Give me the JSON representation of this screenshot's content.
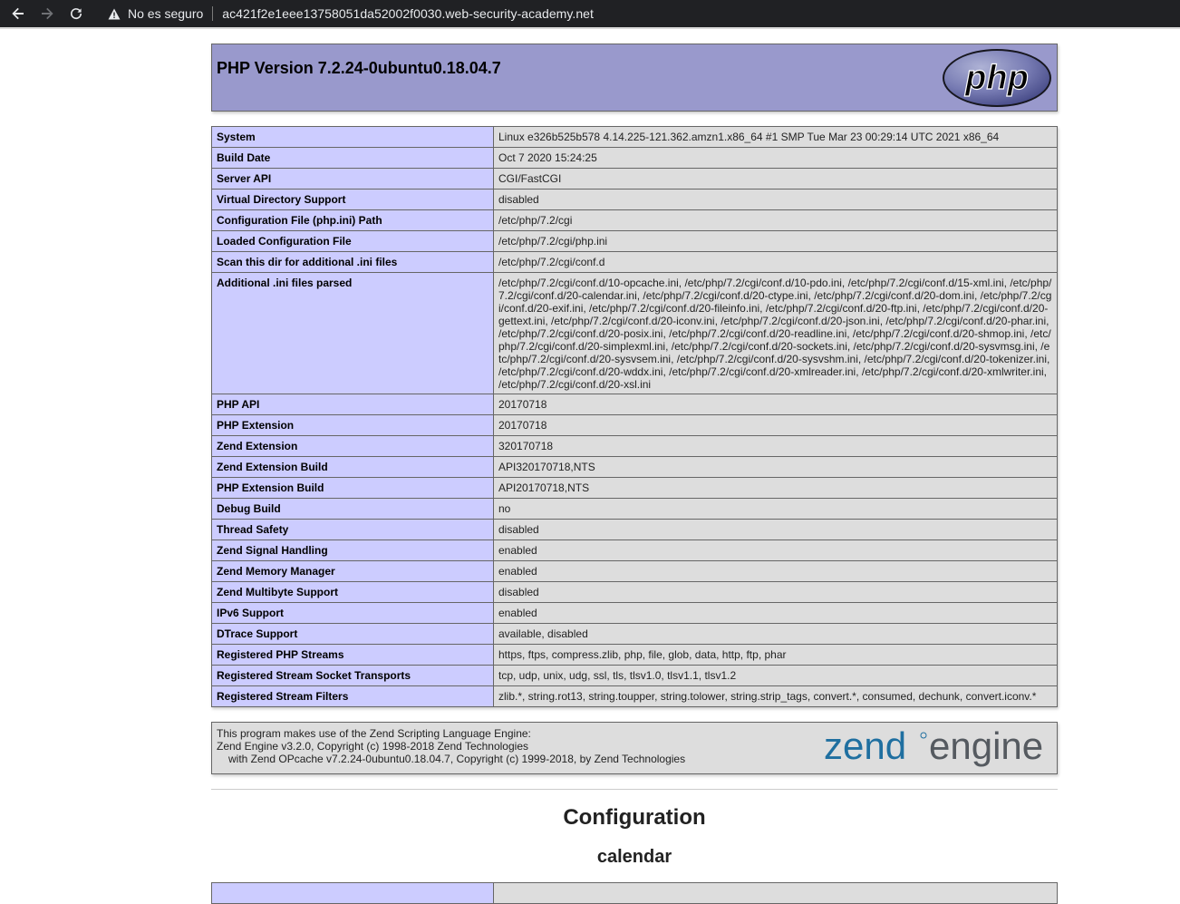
{
  "browser": {
    "security_label": "No es seguro",
    "url": "ac421f2e1eee13758051da52002f0030.web-security-academy.net"
  },
  "header": {
    "title": "PHP Version 7.2.24-0ubuntu0.18.04.7",
    "logo_text": "php"
  },
  "info_rows": [
    {
      "key": "System",
      "value": "Linux e326b525b578 4.14.225-121.362.amzn1.x86_64 #1 SMP Tue Mar 23 00:29:14 UTC 2021 x86_64"
    },
    {
      "key": "Build Date",
      "value": "Oct 7 2020 15:24:25"
    },
    {
      "key": "Server API",
      "value": "CGI/FastCGI"
    },
    {
      "key": "Virtual Directory Support",
      "value": "disabled"
    },
    {
      "key": "Configuration File (php.ini) Path",
      "value": "/etc/php/7.2/cgi"
    },
    {
      "key": "Loaded Configuration File",
      "value": "/etc/php/7.2/cgi/php.ini"
    },
    {
      "key": "Scan this dir for additional .ini files",
      "value": "/etc/php/7.2/cgi/conf.d"
    },
    {
      "key": "Additional .ini files parsed",
      "value": "/etc/php/7.2/cgi/conf.d/10-opcache.ini, /etc/php/7.2/cgi/conf.d/10-pdo.ini, /etc/php/7.2/cgi/conf.d/15-xml.ini, /etc/php/7.2/cgi/conf.d/20-calendar.ini, /etc/php/7.2/cgi/conf.d/20-ctype.ini, /etc/php/7.2/cgi/conf.d/20-dom.ini, /etc/php/7.2/cgi/conf.d/20-exif.ini, /etc/php/7.2/cgi/conf.d/20-fileinfo.ini, /etc/php/7.2/cgi/conf.d/20-ftp.ini, /etc/php/7.2/cgi/conf.d/20-gettext.ini, /etc/php/7.2/cgi/conf.d/20-iconv.ini, /etc/php/7.2/cgi/conf.d/20-json.ini, /etc/php/7.2/cgi/conf.d/20-phar.ini, /etc/php/7.2/cgi/conf.d/20-posix.ini, /etc/php/7.2/cgi/conf.d/20-readline.ini, /etc/php/7.2/cgi/conf.d/20-shmop.ini, /etc/php/7.2/cgi/conf.d/20-simplexml.ini, /etc/php/7.2/cgi/conf.d/20-sockets.ini, /etc/php/7.2/cgi/conf.d/20-sysvmsg.ini, /etc/php/7.2/cgi/conf.d/20-sysvsem.ini, /etc/php/7.2/cgi/conf.d/20-sysvshm.ini, /etc/php/7.2/cgi/conf.d/20-tokenizer.ini, /etc/php/7.2/cgi/conf.d/20-wddx.ini, /etc/php/7.2/cgi/conf.d/20-xmlreader.ini, /etc/php/7.2/cgi/conf.d/20-xmlwriter.ini, /etc/php/7.2/cgi/conf.d/20-xsl.ini"
    },
    {
      "key": "PHP API",
      "value": "20170718"
    },
    {
      "key": "PHP Extension",
      "value": "20170718"
    },
    {
      "key": "Zend Extension",
      "value": "320170718"
    },
    {
      "key": "Zend Extension Build",
      "value": "API320170718,NTS"
    },
    {
      "key": "PHP Extension Build",
      "value": "API20170718,NTS"
    },
    {
      "key": "Debug Build",
      "value": "no"
    },
    {
      "key": "Thread Safety",
      "value": "disabled"
    },
    {
      "key": "Zend Signal Handling",
      "value": "enabled"
    },
    {
      "key": "Zend Memory Manager",
      "value": "enabled"
    },
    {
      "key": "Zend Multibyte Support",
      "value": "disabled"
    },
    {
      "key": "IPv6 Support",
      "value": "enabled"
    },
    {
      "key": "DTrace Support",
      "value": "available, disabled"
    },
    {
      "key": "Registered PHP Streams",
      "value": "https, ftps, compress.zlib, php, file, glob, data, http, ftp, phar"
    },
    {
      "key": "Registered Stream Socket Transports",
      "value": "tcp, udp, unix, udg, ssl, tls, tlsv1.0, tlsv1.1, tlsv1.2"
    },
    {
      "key": "Registered Stream Filters",
      "value": "zlib.*, string.rot13, string.toupper, string.tolower, string.strip_tags, convert.*, consumed, dechunk, convert.iconv.*"
    }
  ],
  "zend": {
    "line1": "This program makes use of the Zend Scripting Language Engine:",
    "line2": "Zend Engine v3.2.0, Copyright (c) 1998-2018 Zend Technologies",
    "line3": "with Zend OPcache v7.2.24-0ubuntu0.18.04.7, Copyright (c) 1999-2018, by Zend Technologies",
    "logo_zend": "zend",
    "logo_engine": "engine"
  },
  "sections": {
    "configuration": "Configuration",
    "calendar": "calendar"
  },
  "colors": {
    "header_bg": "#9999cc",
    "key_bg": "#ccccff",
    "value_bg": "#dddddd",
    "zend_blue": "#1f6fa0"
  }
}
